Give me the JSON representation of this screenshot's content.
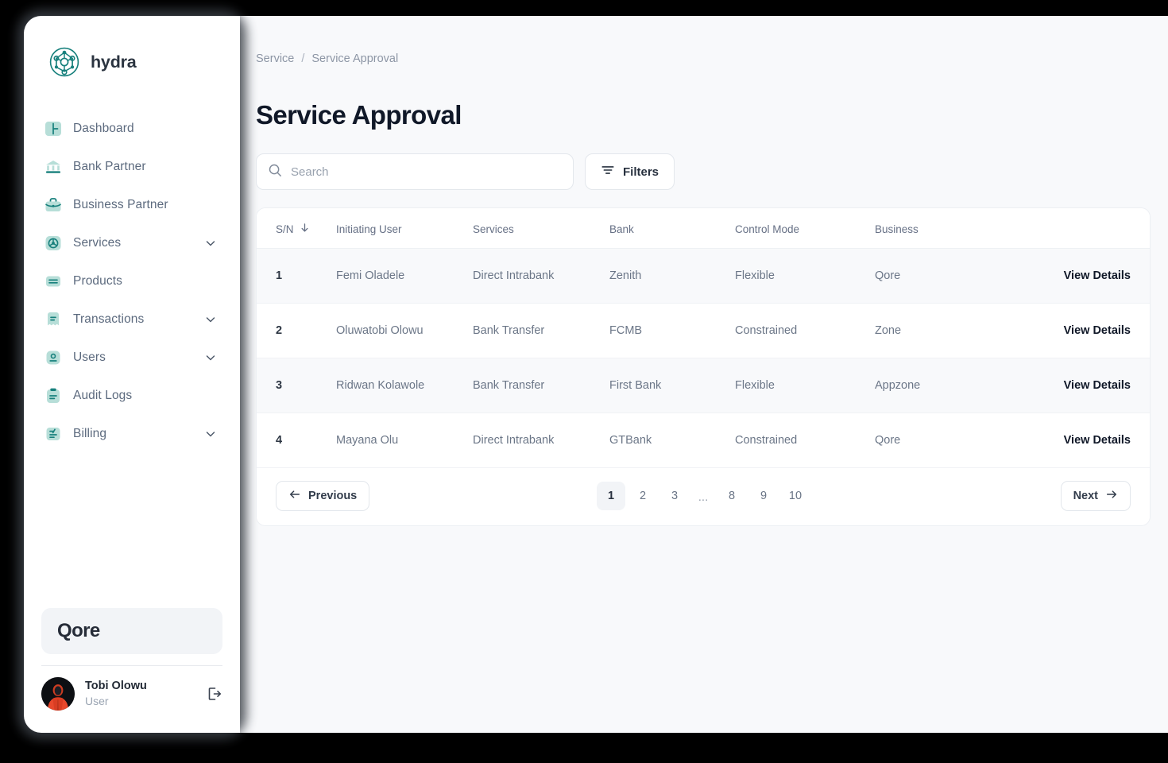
{
  "brand": {
    "name": "hydra",
    "logo_icon": "hydra-network-logo",
    "accent": "#17807c"
  },
  "sidebar": {
    "items": [
      {
        "label": "Dashboard",
        "icon": "dashboard-icon",
        "expandable": false
      },
      {
        "label": "Bank Partner",
        "icon": "bank-icon",
        "expandable": false
      },
      {
        "label": "Business Partner",
        "icon": "briefcase-icon",
        "expandable": false
      },
      {
        "label": "Services",
        "icon": "services-wheel-icon",
        "expandable": true
      },
      {
        "label": "Products",
        "icon": "products-icon",
        "expandable": false
      },
      {
        "label": "Transactions",
        "icon": "transactions-icon",
        "expandable": true
      },
      {
        "label": "Users",
        "icon": "users-icon",
        "expandable": true
      },
      {
        "label": "Audit Logs",
        "icon": "audit-logs-icon",
        "expandable": false
      },
      {
        "label": "Billing",
        "icon": "billing-icon",
        "expandable": true
      }
    ],
    "organization": "Qore",
    "user": {
      "name": "Tobi Olowu",
      "role": "User",
      "logout_icon": "logout-icon"
    }
  },
  "breadcrumb": {
    "parent": "Service",
    "separator": "/",
    "current": "Service Approval"
  },
  "page": {
    "title": "Service Approval"
  },
  "toolbar": {
    "search_placeholder": "Search",
    "search_value": "",
    "search_icon": "search-icon",
    "filters_label": "Filters",
    "filters_icon": "filter-lines-icon"
  },
  "table": {
    "columns": [
      {
        "label": "S/N",
        "sort_icon": "arrow-down-icon"
      },
      {
        "label": "Initiating User"
      },
      {
        "label": "Services"
      },
      {
        "label": "Bank"
      },
      {
        "label": "Control Mode"
      },
      {
        "label": "Business"
      },
      {
        "label": ""
      }
    ],
    "action_label": "View Details",
    "rows": [
      {
        "sn": "1",
        "user": "Femi Oladele",
        "service": "Direct Intrabank",
        "bank": "Zenith",
        "control_mode": "Flexible",
        "business": "Qore"
      },
      {
        "sn": "2",
        "user": "Oluwatobi Olowu",
        "service": "Bank Transfer",
        "bank": "FCMB",
        "control_mode": "Constrained",
        "business": "Zone"
      },
      {
        "sn": "3",
        "user": "Ridwan Kolawole",
        "service": "Bank Transfer",
        "bank": "First Bank",
        "control_mode": "Flexible",
        "business": "Appzone"
      },
      {
        "sn": "4",
        "user": "Mayana Olu",
        "service": "Direct Intrabank",
        "bank": "GTBank",
        "control_mode": "Constrained",
        "business": "Qore"
      }
    ]
  },
  "pagination": {
    "previous_label": "Previous",
    "next_label": "Next",
    "previous_icon": "arrow-left-icon",
    "next_icon": "arrow-right-icon",
    "pages": [
      "1",
      "2",
      "3",
      "...",
      "8",
      "9",
      "10"
    ],
    "active_page": "1"
  }
}
